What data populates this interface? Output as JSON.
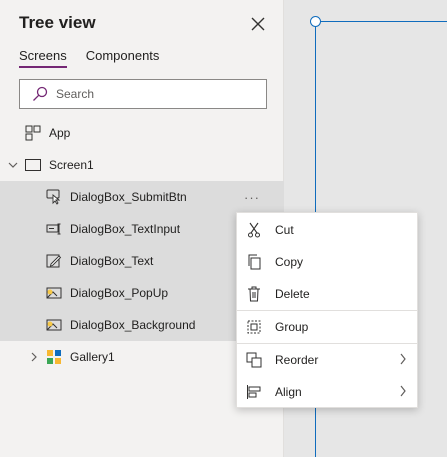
{
  "panel": {
    "title": "Tree view",
    "tabs": [
      {
        "label": "Screens",
        "active": true
      },
      {
        "label": "Components",
        "active": false
      }
    ],
    "search_placeholder": "Search"
  },
  "tree": {
    "app": "App",
    "screen": "Screen1",
    "children": [
      {
        "label": "DialogBox_SubmitBtn",
        "icon": "button-icon"
      },
      {
        "label": "DialogBox_TextInput",
        "icon": "text-input-icon"
      },
      {
        "label": "DialogBox_Text",
        "icon": "label-edit-icon"
      },
      {
        "label": "DialogBox_PopUp",
        "icon": "image-icon"
      },
      {
        "label": "DialogBox_Background",
        "icon": "image-icon"
      }
    ],
    "gallery": "Gallery1",
    "more_label": "···"
  },
  "context_menu": {
    "items": [
      {
        "label": "Cut",
        "icon": "scissors-icon"
      },
      {
        "label": "Copy",
        "icon": "copy-icon"
      },
      {
        "label": "Delete",
        "icon": "trash-icon"
      },
      {
        "label": "Group",
        "icon": "group-icon"
      },
      {
        "label": "Reorder",
        "icon": "reorder-icon",
        "submenu": true
      },
      {
        "label": "Align",
        "icon": "align-icon",
        "submenu": true
      }
    ]
  },
  "colors": {
    "accent": "#742774",
    "selection": "#0f6cbd",
    "selected_row": "#dcdcdc"
  }
}
